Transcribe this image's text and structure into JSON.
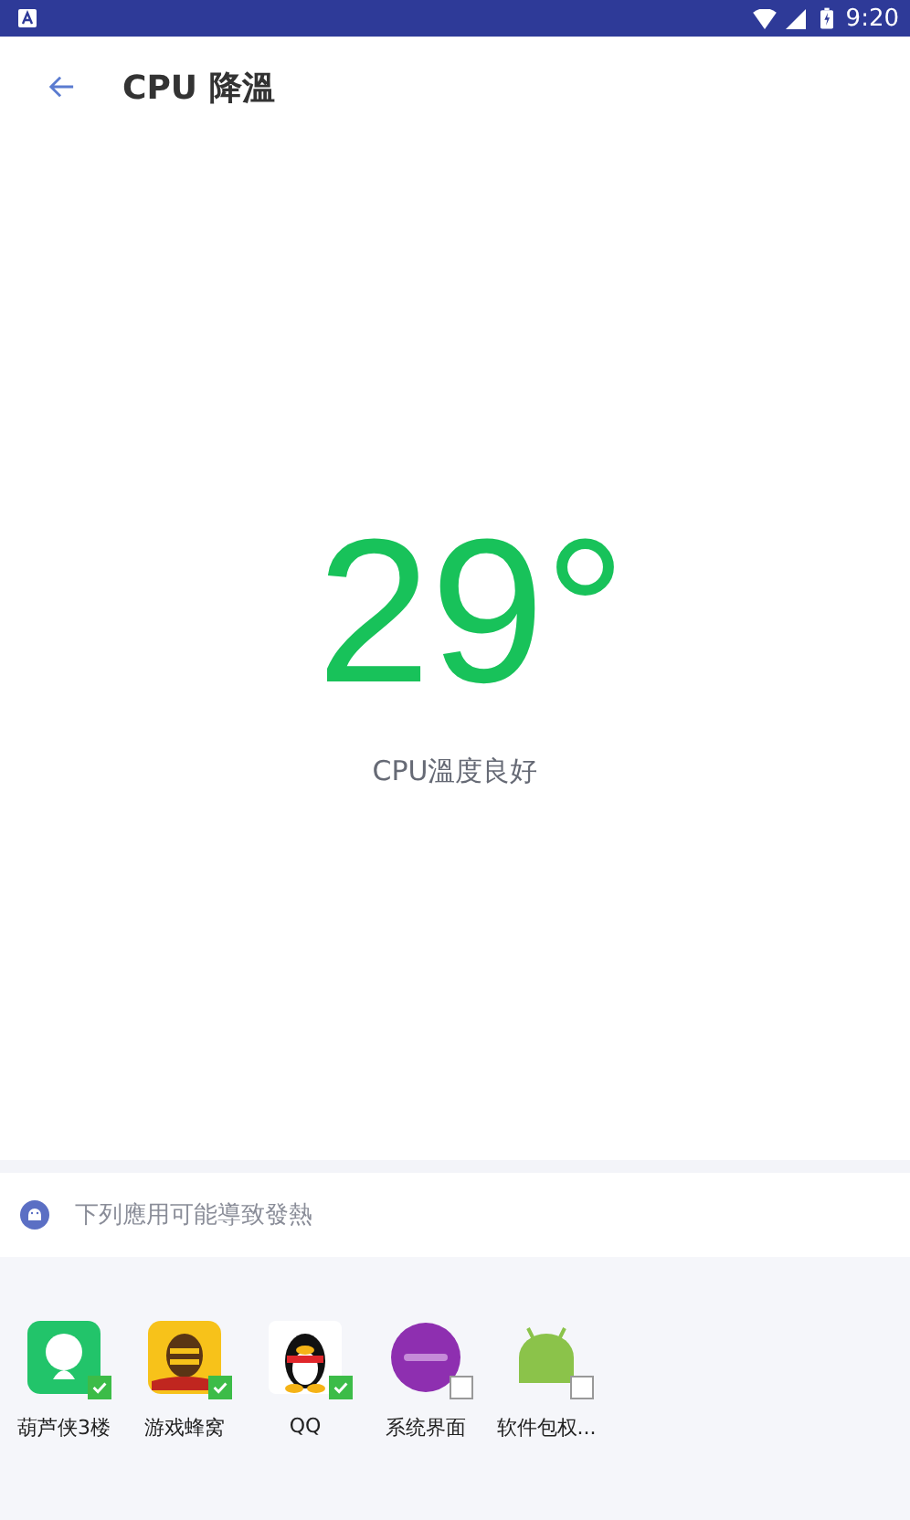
{
  "status_bar": {
    "time": "9:20"
  },
  "header": {
    "title": "CPU 降溫"
  },
  "temperature": {
    "value": "29°",
    "status": "CPU溫度良好"
  },
  "notice": {
    "text": "下列應用可能導致發熱"
  },
  "apps": [
    {
      "name": "葫芦侠3楼",
      "kind": "bubble",
      "checked": true
    },
    {
      "name": "游戏蜂窝",
      "kind": "bee",
      "checked": true
    },
    {
      "name": "QQ",
      "kind": "penguin",
      "checked": true
    },
    {
      "name": "系统界面",
      "kind": "circle",
      "checked": false
    },
    {
      "name": "软件包权...",
      "kind": "android",
      "checked": false
    }
  ]
}
